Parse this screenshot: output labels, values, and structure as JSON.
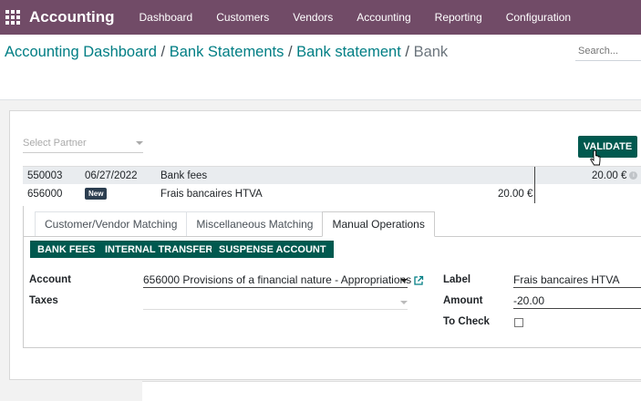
{
  "app": {
    "title": "Accounting",
    "menu": [
      "Dashboard",
      "Customers",
      "Vendors",
      "Accounting",
      "Reporting",
      "Configuration"
    ]
  },
  "breadcrumb": {
    "items": [
      "Accounting Dashboard",
      "Bank Statements",
      "Bank statement"
    ],
    "separator": "/",
    "current": "Bank"
  },
  "search": {
    "placeholder": "Search..."
  },
  "partner": {
    "placeholder": "Select Partner"
  },
  "validate_label": "VALIDATE",
  "lines": [
    {
      "account": "550003",
      "date": "06/27/2022",
      "label": "Bank fees",
      "amount": "",
      "balance": "20.00 €"
    },
    {
      "account": "656000",
      "badge": "New",
      "label": "Frais bancaires HTVA",
      "amount": "20.00 €"
    }
  ],
  "tabs": [
    "Customer/Vendor Matching",
    "Miscellaneous Matching",
    "Manual Operations"
  ],
  "active_tab": "Manual Operations",
  "model_buttons": [
    "BANK FEES",
    "INTERNAL TRANSFER",
    "SUSPENSE ACCOUNT"
  ],
  "form": {
    "account_label": "Account",
    "account_value": "656000 Provisions of a financial nature - Appropriations",
    "taxes_label": "Taxes",
    "taxes_value": "",
    "label_label": "Label",
    "label_value": "Frais bancaires HTVA",
    "amount_label": "Amount",
    "amount_value": "-20.00",
    "to_check_label": "To Check",
    "to_check": false
  },
  "colors": {
    "navbar": "#714b67",
    "primary_button": "#00594f",
    "link": "#017e84"
  }
}
